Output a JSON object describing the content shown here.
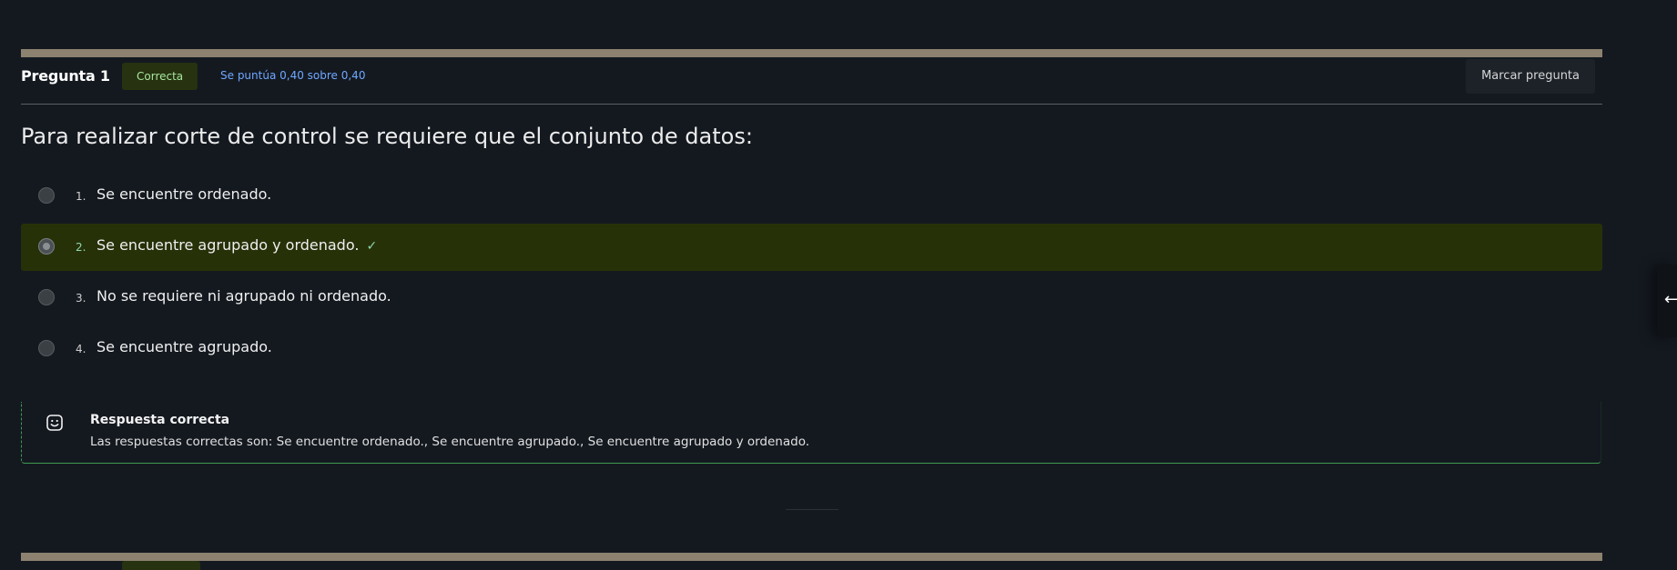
{
  "question": {
    "title": "Pregunta 1",
    "status": "Correcta",
    "score": "Se puntúa 0,40 sobre 0,40",
    "flag_label": "Marcar pregunta",
    "text": "Para realizar corte de control se requiere que el conjunto de datos:"
  },
  "answers": [
    {
      "num": "1.",
      "text": "Se encuentre ordenado.",
      "selected": false
    },
    {
      "num": "2.",
      "text": "Se encuentre agrupado y ordenado.",
      "selected": true,
      "check": "✓"
    },
    {
      "num": "3.",
      "text": "No se requiere ni agrupado ni ordenado.",
      "selected": false
    },
    {
      "num": "4.",
      "text": "Se encuentre agrupado.",
      "selected": false
    }
  ],
  "feedback": {
    "icon": "smile-icon",
    "title": "Respuesta correcta",
    "text": "Las respuestas correctas son: Se encuentre ordenado., Se encuentre agrupado., Se encuentre agrupado y ordenado."
  },
  "side_tab": {
    "icon": "arrow-left-icon",
    "glyph": "←"
  },
  "colors": {
    "background": "#141920",
    "bar": "#8c826f",
    "correct_badge": "#263210",
    "selected_row": "#273108",
    "score_text": "#6fa8ff",
    "feedback_border": "#3f9a52"
  }
}
